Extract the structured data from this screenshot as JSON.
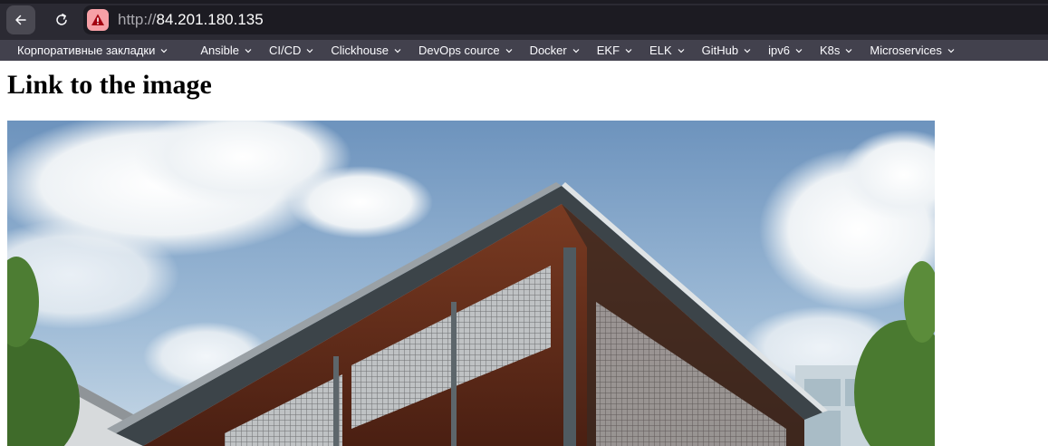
{
  "browser": {
    "url_scheme": "http://",
    "url_host": "84.201.180.135",
    "security_status": "not-secure",
    "icons": {
      "back": "arrow-left-icon",
      "reload": "reload-icon",
      "security": "warning-triangle-icon"
    }
  },
  "bookmarks": [
    {
      "label": "Корпоративные закладки"
    },
    {
      "label": "Ansible"
    },
    {
      "label": "CI/CD"
    },
    {
      "label": "Clickhouse"
    },
    {
      "label": "DevOps cource"
    },
    {
      "label": "Docker"
    },
    {
      "label": "EKF"
    },
    {
      "label": "ELK"
    },
    {
      "label": "GitHub"
    },
    {
      "label": "ipv6"
    },
    {
      "label": "K8s"
    },
    {
      "label": "Microservices"
    }
  ],
  "page": {
    "heading": "Link to the image"
  },
  "colors": {
    "toolbar_bg": "#2b2a33",
    "address_bg": "#1c1b22",
    "bookmarks_bg": "#42414d",
    "warning_bg": "#f7a0a6",
    "warning_fg": "#a4000f"
  }
}
